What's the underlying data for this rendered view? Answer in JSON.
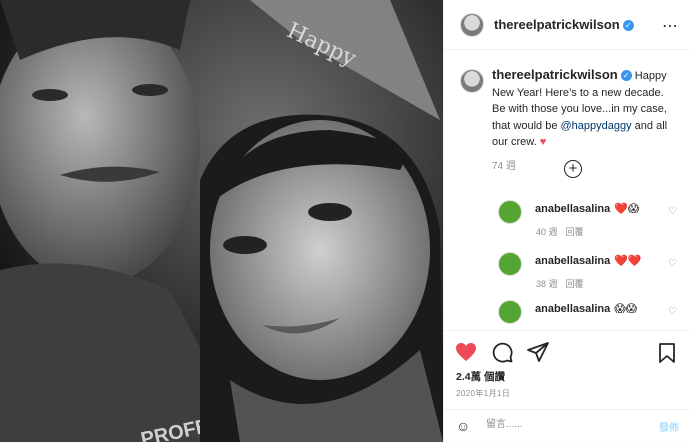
{
  "account": {
    "username": "thereelpatrickwilson",
    "verified_glyph": "✓"
  },
  "header": {
    "more_icon": "⋯"
  },
  "caption": {
    "username": "thereelpatrickwilson",
    "text_before": "Happy New Year! Here’s to a new decade. Be with those you love...in my case, that would be",
    "mention": "@happydaggy",
    "text_after": "and all our crew.",
    "heart": "♥",
    "meta": "74 週"
  },
  "load_more_icon": "+",
  "comments": [
    {
      "username": "anabellasalina",
      "emoji": "❤️😱",
      "time": "40 週",
      "reply": "回覆",
      "like_icon": "♡"
    },
    {
      "username": "anabellasalina",
      "emoji": "❤️❤️",
      "time": "38 週",
      "reply": "回覆",
      "like_icon": "♡"
    },
    {
      "username": "anabellasalina",
      "emoji": "😱😱",
      "time": "",
      "reply": "",
      "like_icon": "♡"
    }
  ],
  "actions": {
    "likes": "2.4萬 個讚",
    "date": "2020年1月1日",
    "colors": {
      "liked": "#ed4956",
      "post_button": "#b2dffc",
      "mention": "#00376b"
    }
  },
  "add_comment": {
    "emoji_icon": "☺",
    "placeholder": "留言......",
    "post_label": "發佈"
  },
  "photo": {
    "hat_text": "Happy",
    "shirt_text": "PROFESSION"
  }
}
